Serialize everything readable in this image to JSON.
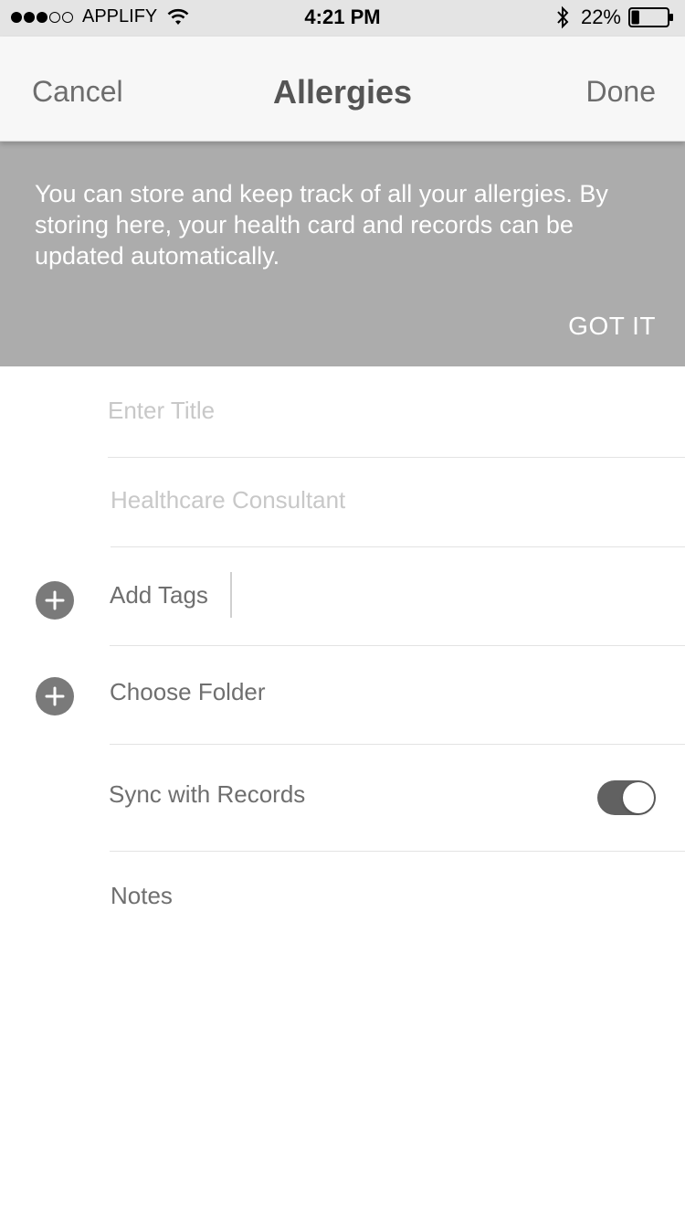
{
  "status_bar": {
    "carrier": "APPLIFY",
    "time": "4:21 PM",
    "battery_percent": "22%",
    "signal_bars": 3,
    "signal_total": 5,
    "battery_level": 0.22,
    "icons": [
      "signal-dots-icon",
      "wifi-icon",
      "bluetooth-icon",
      "battery-icon"
    ]
  },
  "nav": {
    "cancel_label": "Cancel",
    "title": "Allergies",
    "done_label": "Done"
  },
  "banner": {
    "message": "You can store and keep track of all your allergies. By storing here, your health card and records can be updated automatically.",
    "dismiss_label": "GOT IT"
  },
  "form": {
    "title_placeholder": "Enter Title",
    "consultant_placeholder": "Healthcare Consultant",
    "add_tags_label": "Add Tags",
    "choose_folder_label": "Choose Folder",
    "sync_label": "Sync with Records",
    "sync_enabled": true,
    "notes_label": "Notes",
    "icons": [
      "plus-circle-icon"
    ]
  },
  "colors": {
    "status_bar_bg": "#e4e4e4",
    "nav_bg": "#f7f7f7",
    "banner_bg": "#acacac",
    "accent_gray": "#7a7a7a",
    "toggle_on": "#616161"
  }
}
